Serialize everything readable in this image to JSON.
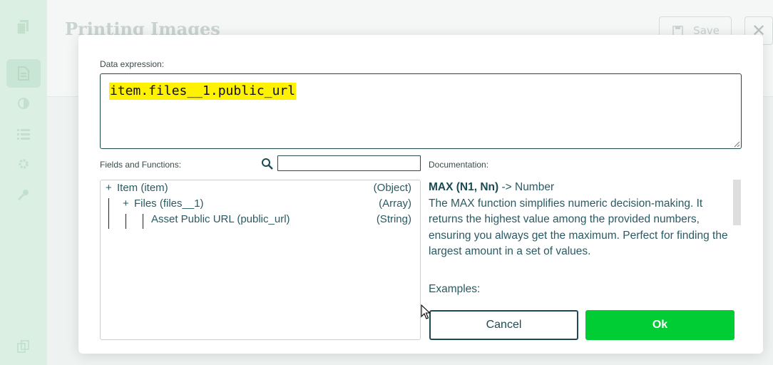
{
  "background": {
    "page_title": "Printing Images",
    "save_label": "Save",
    "close_glyph": "✕",
    "sidebar_icons": [
      "document-stack-icon",
      "file-icon",
      "contrast-icon",
      "list-icon",
      "gear-icon",
      "key-icon",
      "copy-icon"
    ]
  },
  "dialog": {
    "expression_label": "Data expression:",
    "expression_value": "item.files__1.public_url",
    "fields_label": "Fields and Functions:",
    "search_placeholder": "",
    "documentation_label": "Documentation:",
    "tree": [
      {
        "expander": "+",
        "name": "Item (item)",
        "type": "(Object)",
        "depth": 0
      },
      {
        "expander": "+",
        "name": "Files (files__1)",
        "type": "(Array)",
        "depth": 1
      },
      {
        "expander": "",
        "name": "Asset Public URL (public_url)",
        "type": "(String)",
        "depth": 2
      }
    ],
    "doc": {
      "signature": "MAX (N1, Nn)",
      "returns": " -> Number",
      "description": "The MAX function simplifies numeric decision-making. It returns the highest value among the provided numbers, ensuring you always get the maximum. Perfect for finding the largest amount in a set of values.",
      "examples_label": "Examples:"
    },
    "cancel_label": "Cancel",
    "ok_label": "Ok",
    "colors": {
      "accent_green": "#00cc33",
      "highlight": "#fff200",
      "dark_teal": "#1c4a52"
    }
  }
}
